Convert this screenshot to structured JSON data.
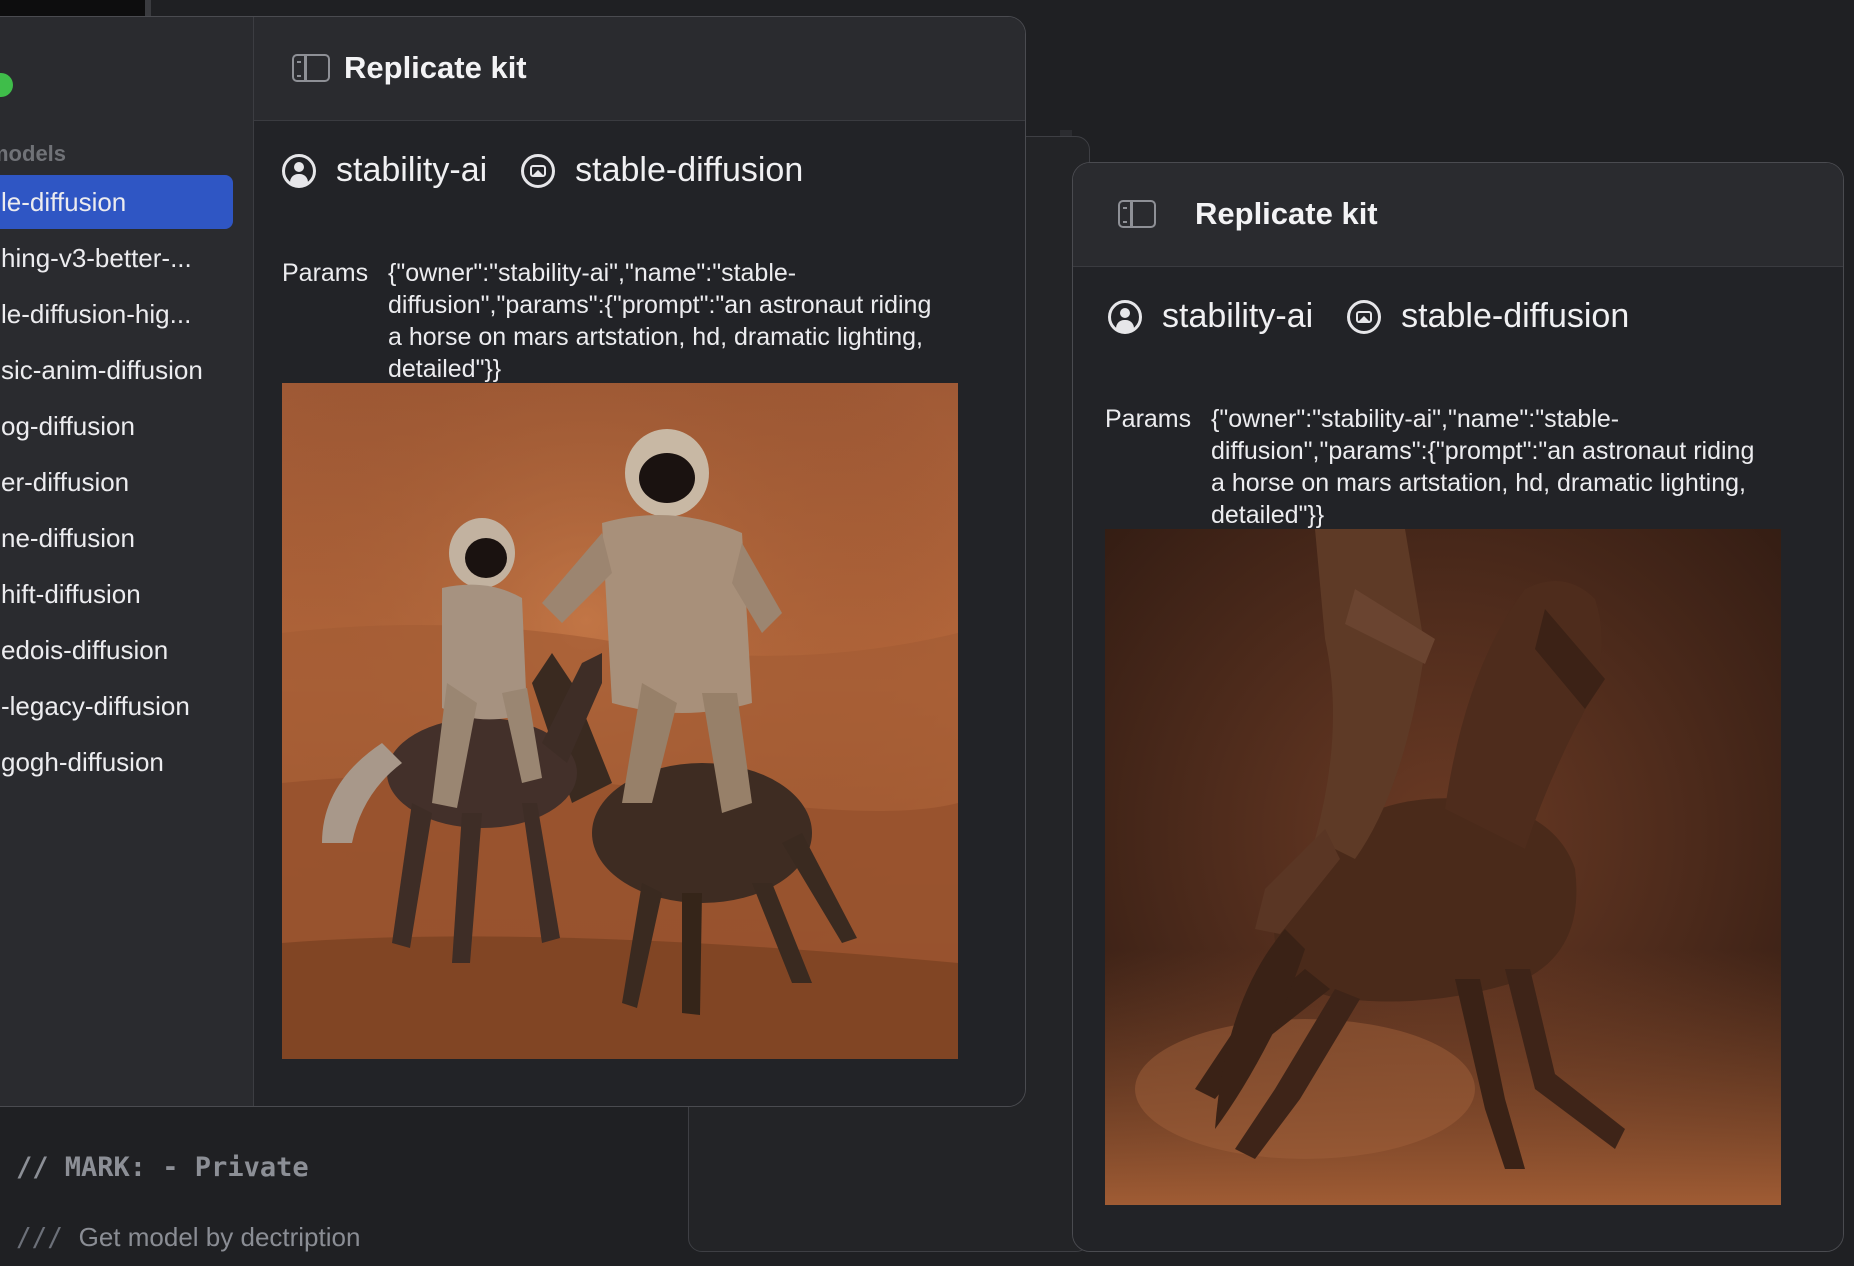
{
  "app": {
    "title": "Replicate kit"
  },
  "sidebar": {
    "heading": "models",
    "items": [
      {
        "label": "le-diffusion",
        "selected": true
      },
      {
        "label": "hing-v3-better-..."
      },
      {
        "label": "le-diffusion-hig..."
      },
      {
        "label": "sic-anim-diffusion"
      },
      {
        "label": "og-diffusion"
      },
      {
        "label": "er-diffusion"
      },
      {
        "label": "ne-diffusion"
      },
      {
        "label": "hift-diffusion"
      },
      {
        "label": "edois-diffusion"
      },
      {
        "label": "-legacy-diffusion"
      },
      {
        "label": "gogh-diffusion"
      }
    ]
  },
  "detail": {
    "owner": "stability-ai",
    "model": "stable-diffusion",
    "params_label": "Params",
    "params_value": "{\"owner\":\"stability-ai\",\"name\":\"stable-diffusion\",\"params\":{\"prompt\":\"an astronaut riding a horse on mars artstation, hd, dramatic lighting, detailed\"}}"
  },
  "editor": {
    "mark_comment": "// MARK: - Private",
    "doc_prefix": "///",
    "doc_text": "Get model by dectription"
  },
  "colors": {
    "accent_selection": "#2f56c4",
    "traffic_green": "#3fbd4a",
    "window_bg": "#222327"
  },
  "icons": {
    "sidebar_toggle": "sidebar-toggle-icon",
    "owner": "person-circle-icon",
    "model": "photo-circle-icon"
  }
}
